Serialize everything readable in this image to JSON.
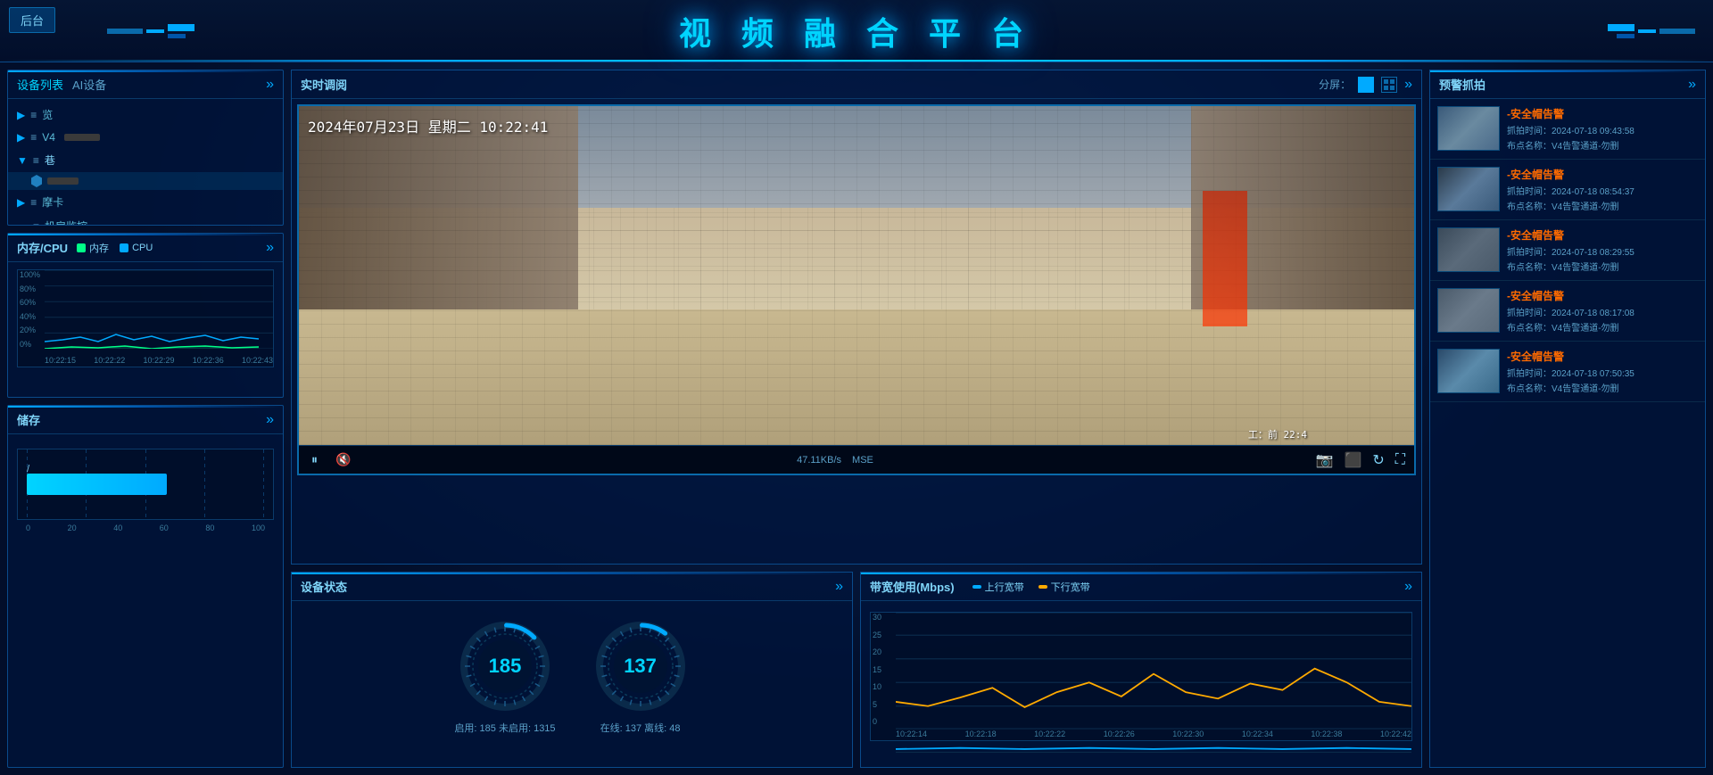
{
  "header": {
    "title": "视 频 融 合 平 台",
    "back_button": "后台"
  },
  "left_panel": {
    "device_list_tab": "设备列表",
    "ai_tab": "AI设备",
    "expand_icon": "»",
    "devices": [
      {
        "id": "d1",
        "name": "览",
        "type": "group",
        "expanded": false,
        "indent": 0
      },
      {
        "id": "d2",
        "name": "V4",
        "type": "group",
        "expanded": false,
        "indent": 0
      },
      {
        "id": "d3",
        "name": "巷",
        "type": "group",
        "expanded": true,
        "indent": 0
      },
      {
        "id": "d3-sub",
        "name": "",
        "type": "shield",
        "indent": 1
      },
      {
        "id": "d4",
        "name": "摩卡",
        "type": "group",
        "expanded": false,
        "indent": 0
      },
      {
        "id": "d5",
        "name": "机房监控",
        "type": "camera",
        "expanded": false,
        "indent": 0
      }
    ],
    "cpu_panel": {
      "title": "内存/CPU",
      "legend_memory": "内存",
      "legend_cpu": "CPU",
      "memory_color": "#00ff88",
      "cpu_color": "#00aaff",
      "y_labels": [
        "100%",
        "80%",
        "60%",
        "40%",
        "20%",
        "0%"
      ],
      "x_labels": [
        "10:22:15",
        "10:22:22",
        "10:22:29",
        "10:22:36",
        "10:22:43"
      ]
    },
    "storage_panel": {
      "title": "储存",
      "label": "/",
      "bar_width_percent": 55,
      "x_labels": [
        "0",
        "20",
        "40",
        "60",
        "80",
        "100"
      ]
    }
  },
  "center_panel": {
    "video_panel": {
      "title": "实时调阅",
      "split_label": "分屏：",
      "timestamp": "2024年07月23日  星期二  10:22:41",
      "speed": "47.11KB/s",
      "quality": "MSE"
    },
    "device_status": {
      "title": "设备状态",
      "online_count": "185",
      "offline_count": "1315",
      "online_stream_count": "137",
      "offline_stream_count": "48",
      "status_label1": "启用: 185 未启用: 1315",
      "status_label2": "在线: 137 离线: 48"
    },
    "bandwidth": {
      "title": "带宽使用(Mbps)",
      "legend_up": "上行宽带",
      "legend_down": "下行宽带",
      "up_color": "#00aaff",
      "down_color": "#ffaa00",
      "y_labels": [
        "30",
        "25",
        "20",
        "15",
        "10",
        "5",
        "0"
      ],
      "x_labels": [
        "10:22:14",
        "10:22:18",
        "10:22:22",
        "10:22:26",
        "10:22:30",
        "10:22:34",
        "10:22:38",
        "10:22:42"
      ]
    }
  },
  "right_panel": {
    "title": "预警抓拍",
    "expand_icon": "»",
    "alerts": [
      {
        "id": "a1",
        "name": "-安全帽告警",
        "time": "抓拍时间：2024-07-18 09:43:58",
        "location": "布点名称：V4告警通道-勿删"
      },
      {
        "id": "a2",
        "name": "-安全帽告警",
        "time": "抓拍时间：2024-07-18 08:54:37",
        "location": "布点名称：V4告警通道-勿删"
      },
      {
        "id": "a3",
        "name": "-安全帽告警",
        "time": "抓拍时间：2024-07-18 08:29:55",
        "location": "布点名称：V4告警通道-勿删"
      },
      {
        "id": "a4",
        "name": "-安全帽告警",
        "time": "抓拍时间：2024-07-18 08:17:08",
        "location": "布点名称：V4告警通道-勿删"
      },
      {
        "id": "a5",
        "name": "-安全帽告警",
        "time": "抓拍时间：2024-07-18 07:50:35",
        "location": "布点名称：V4告警通道-勿删"
      }
    ]
  }
}
